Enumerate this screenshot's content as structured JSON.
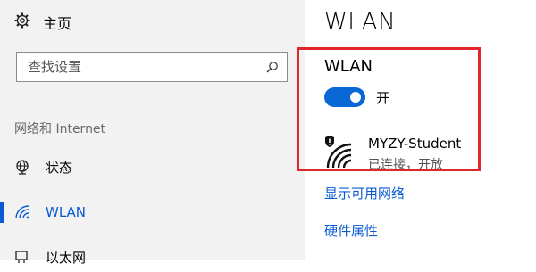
{
  "sidebar": {
    "home_label": "主页",
    "search_placeholder": "查找设置",
    "section_label": "网络和 Internet",
    "items": [
      {
        "label": "状态",
        "icon": "globe-icon"
      },
      {
        "label": "WLAN",
        "icon": "wifi-icon",
        "active": true
      },
      {
        "label": "以太网",
        "icon": "ethernet-icon"
      }
    ]
  },
  "main": {
    "page_title": "WLAN",
    "wlan_heading": "WLAN",
    "toggle_state": "开",
    "network": {
      "name": "MYZY-Student",
      "status": "已连接，开放",
      "icon": "wifi-shield-icon"
    },
    "links": {
      "show_available": "显示可用网络",
      "hardware_properties": "硬件属性"
    }
  },
  "colors": {
    "accent": "#0a5bd3",
    "highlight_border": "#e0272b",
    "sidebar_bg": "#f2f2f2"
  }
}
